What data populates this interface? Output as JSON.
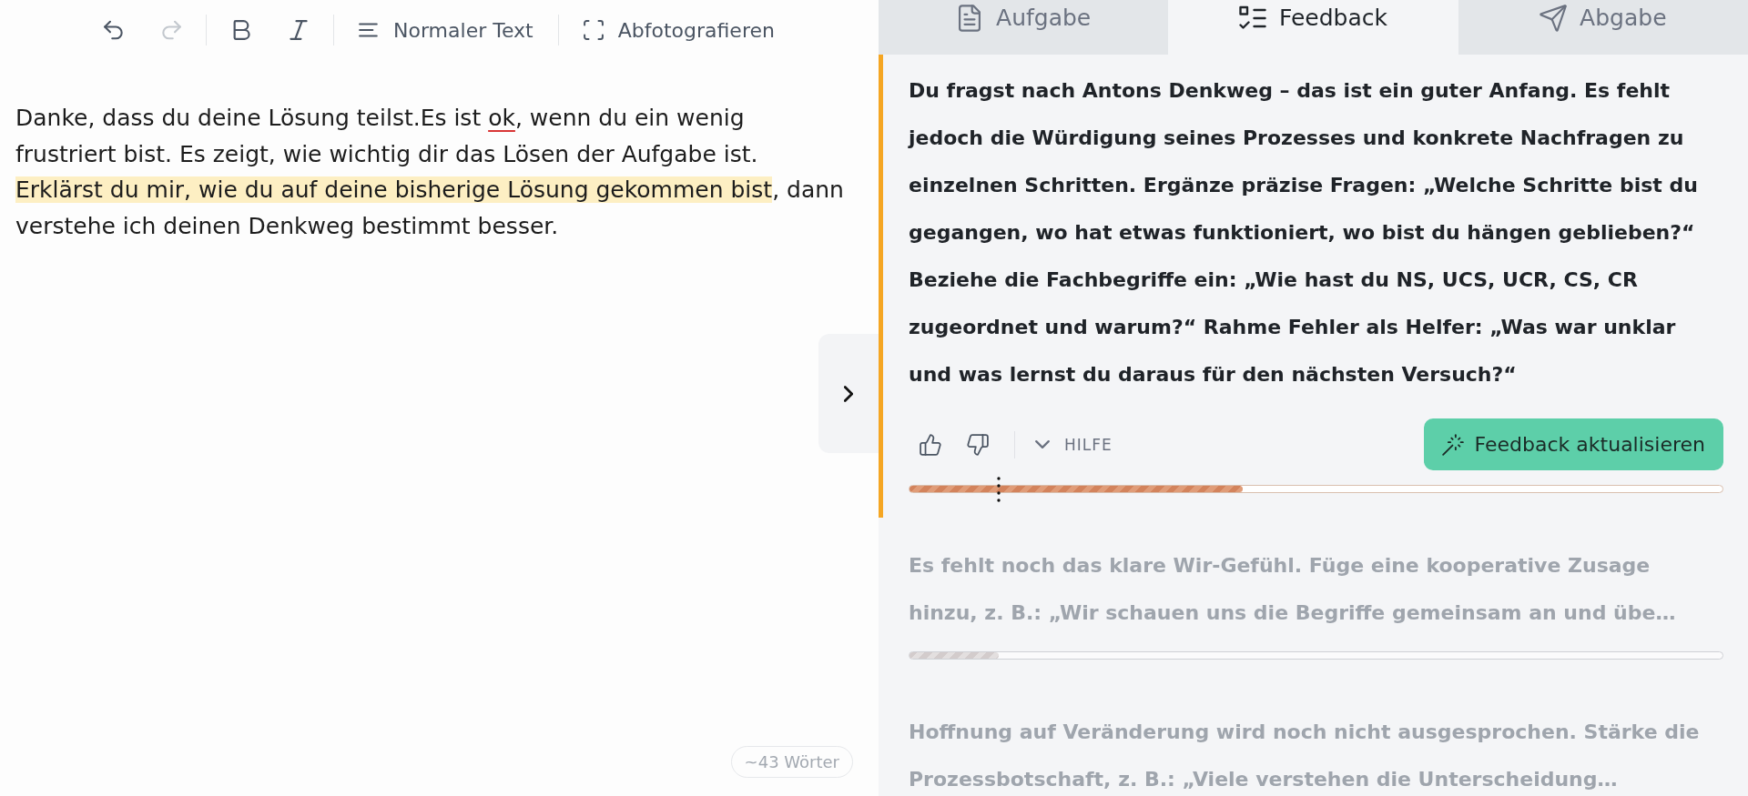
{
  "toolbar": {
    "groups": [
      {
        "items": [
          {
            "kind": "undo",
            "disabled": false
          },
          {
            "kind": "redo",
            "disabled": true
          }
        ]
      },
      {
        "items": [
          {
            "kind": "bold",
            "disabled": false
          },
          {
            "kind": "italic",
            "disabled": false
          }
        ]
      },
      {
        "items": [
          {
            "kind": "text-style",
            "label": "Normaler Text",
            "disabled": false
          }
        ]
      },
      {
        "items": [
          {
            "kind": "scan",
            "label": "Abfotografieren",
            "disabled": false
          }
        ]
      }
    ]
  },
  "editor": {
    "segments": [
      {
        "kind": "plain",
        "text": "Danke, dass du deine Lösung teilst.Es ist "
      },
      {
        "kind": "misspelled",
        "text": "ok"
      },
      {
        "kind": "plain",
        "text": ", wenn du ein wenig frustriert bist. Es zeigt, wie wichtig dir das Lösen der Aufgabe ist. "
      },
      {
        "kind": "highlight",
        "text": "Erklärst du mir, wie du auf deine bisherige Lösung gekommen bist"
      },
      {
        "kind": "plain",
        "text": ", dann verstehe ich deinen Denkweg bestimmt besser."
      }
    ],
    "word_count": "~43 Wörter"
  },
  "tabs": [
    {
      "label": "Aufgabe",
      "selected": false
    },
    {
      "label": "Feedback",
      "selected": true
    },
    {
      "label": "Abgabe",
      "selected": false
    }
  ],
  "feedback": {
    "items": [
      {
        "text": "Du fragst nach Antons Denkweg – das ist ein guter Anfang. Es fehlt jedoch die Würdigung seines Prozesses und konkrete Nachfragen zu einzelnen Schritten. Ergänze präzise Fragen: „Welche Schritte bist du gegangen, wo hat etwas funktioniert, wo bist du hängen geblieben?“ Beziehe die Fachbegriffe ein: „Wie hast du NS, UCS, UCR, CS, CR zugeordnet und warum?“ Rahme Fehler als Helfer: „Was war unklar und was lernst du daraus für den nächsten Versuch?“",
        "selected": true,
        "progress": {
          "level": 0.41,
          "marker": {
            "level": 0.11
          }
        }
      },
      {
        "text": "Es fehlt noch das klare Wir-Gefühl. Füge eine kooperative Zusage hinzu, z. B.: „Wir schauen uns die Begriffe gemeinsam an und übe…",
        "selected": false,
        "progress": {
          "level": 0.11
        }
      },
      {
        "text": "Hoffnung auf Veränderung wird noch nicht ausgesprochen. Stärke die Prozessbotschaft, z. B.: „Viele verstehen die Unterscheidung…",
        "selected": false
      }
    ],
    "actions": {
      "help": {
        "label": "HILFE",
        "expanded": false
      },
      "update_button": "Feedback aktualisieren"
    }
  }
}
